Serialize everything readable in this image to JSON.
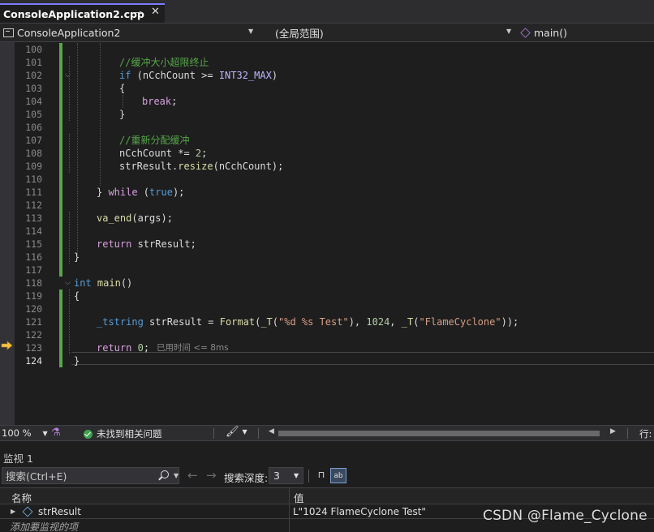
{
  "tab": {
    "title": "ConsoleApplication2.cpp",
    "pin_glyph": "⊸",
    "close_glyph": "✕"
  },
  "navbar": {
    "project": "ConsoleApplication2",
    "scope": "(全局范围)",
    "member": "main()"
  },
  "editor": {
    "lines": [
      {
        "n": "100",
        "text": ""
      },
      {
        "n": "101",
        "text": "//缓冲大小超限终止"
      },
      {
        "n": "102",
        "text": "if (nCchCount >= INT32_MAX)"
      },
      {
        "n": "103",
        "text": "{"
      },
      {
        "n": "104",
        "text": "break;"
      },
      {
        "n": "105",
        "text": "}"
      },
      {
        "n": "106",
        "text": ""
      },
      {
        "n": "107",
        "text": "//重新分配缓冲"
      },
      {
        "n": "108",
        "text": "nCchCount *= 2;"
      },
      {
        "n": "109",
        "text": "strResult.resize(nCchCount);"
      },
      {
        "n": "110",
        "text": ""
      },
      {
        "n": "111",
        "text": "} while (true);"
      },
      {
        "n": "112",
        "text": ""
      },
      {
        "n": "113",
        "text": "va_end(args);"
      },
      {
        "n": "114",
        "text": ""
      },
      {
        "n": "115",
        "text": "return strResult;"
      },
      {
        "n": "116",
        "text": "}"
      },
      {
        "n": "117",
        "text": ""
      },
      {
        "n": "118",
        "text": "int main()"
      },
      {
        "n": "119",
        "text": "{"
      },
      {
        "n": "120",
        "text": ""
      },
      {
        "n": "121",
        "text": "_tstring strResult = Format(_T(\"%d %s Test\"), 1024, _T(\"FlameCyclone\"));"
      },
      {
        "n": "122",
        "text": ""
      },
      {
        "n": "123",
        "text": "return 0;"
      },
      {
        "n": "124",
        "text": "}"
      }
    ],
    "perf_tip": "已用时间 <= 8ms",
    "current_line": "124",
    "execution_line": "123"
  },
  "status": {
    "zoom": "100 %",
    "issues": "未找到相关问题",
    "position": "行:"
  },
  "watch": {
    "title": "监视 1",
    "search_placeholder": "搜索(Ctrl+E)",
    "depth_label": "搜索深度:",
    "depth_value": "3",
    "col_name": "名称",
    "col_value": "值",
    "rows": [
      {
        "name": "strResult",
        "value": "L\"1024 FlameCyclone Test\""
      }
    ],
    "add_item": "添加要监视的项"
  },
  "watermark": "CSDN @Flame_Cyclone",
  "colors": {
    "accent": "#7c7cff",
    "change_bar": "#57a64a",
    "keyword": "#569cd6",
    "control_keyword": "#d8a0df",
    "comment": "#57a64a",
    "function": "#dcdcaa",
    "string": "#d69d85",
    "number": "#b5cea8"
  }
}
